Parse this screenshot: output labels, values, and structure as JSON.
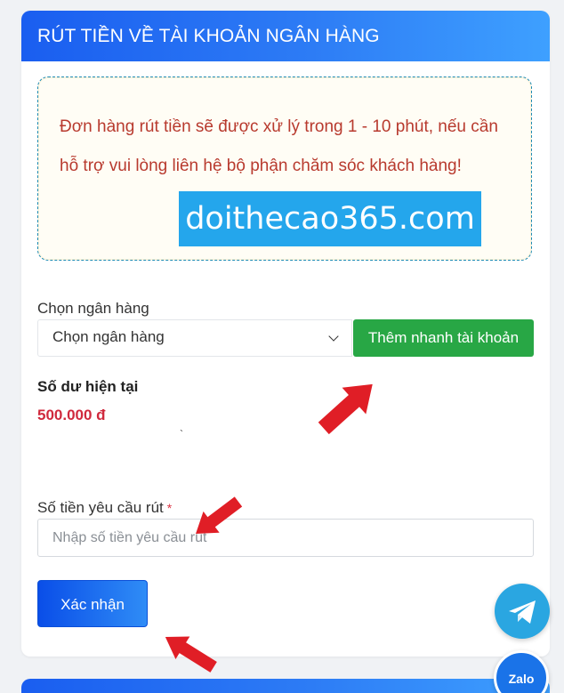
{
  "header": {
    "title": "RÚT TIỀN VỀ TÀI KHOẢN NGÂN HÀNG"
  },
  "notice": {
    "text": "Đơn hàng rút tiền sẽ được xử lý trong 1 - 10 phút, nếu cần hỗ trợ vui lòng liên hệ bộ phận chăm sóc khách hàng!"
  },
  "watermark": {
    "text": "doithecao365.com"
  },
  "bank": {
    "label": "Chọn ngân hàng",
    "select_value": "Chọn ngân hàng",
    "add_button": "Thêm nhanh tài khoản"
  },
  "balance": {
    "title": "Số dư hiện tại",
    "value": "500.000 đ",
    "mark": "`"
  },
  "amount": {
    "label": "Số tiền yêu cầu rút",
    "required_mark": "*",
    "placeholder": "Nhập số tiền yêu cầu rút"
  },
  "submit": {
    "label": "Xác nhận"
  },
  "floating": {
    "telegram_icon": "telegram-icon",
    "zalo_label": "Zalo"
  },
  "colors": {
    "header_gradient_start": "#1a5ef0",
    "header_gradient_end": "#3ea0ff",
    "notice_text": "#b83a2e",
    "add_button": "#28a745",
    "balance_value": "#d0293d",
    "watermark_bg": "#24a6ec",
    "arrow": "#e01e26"
  }
}
